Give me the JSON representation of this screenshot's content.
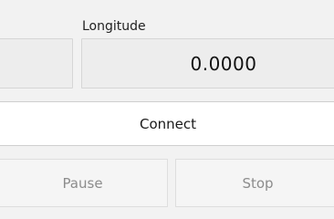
{
  "position": {
    "longitude_label": "Longitude",
    "longitude_value": "0.0000"
  },
  "actions": {
    "connect_label": "Connect",
    "pause_label": "Pause",
    "stop_label": "Stop"
  }
}
